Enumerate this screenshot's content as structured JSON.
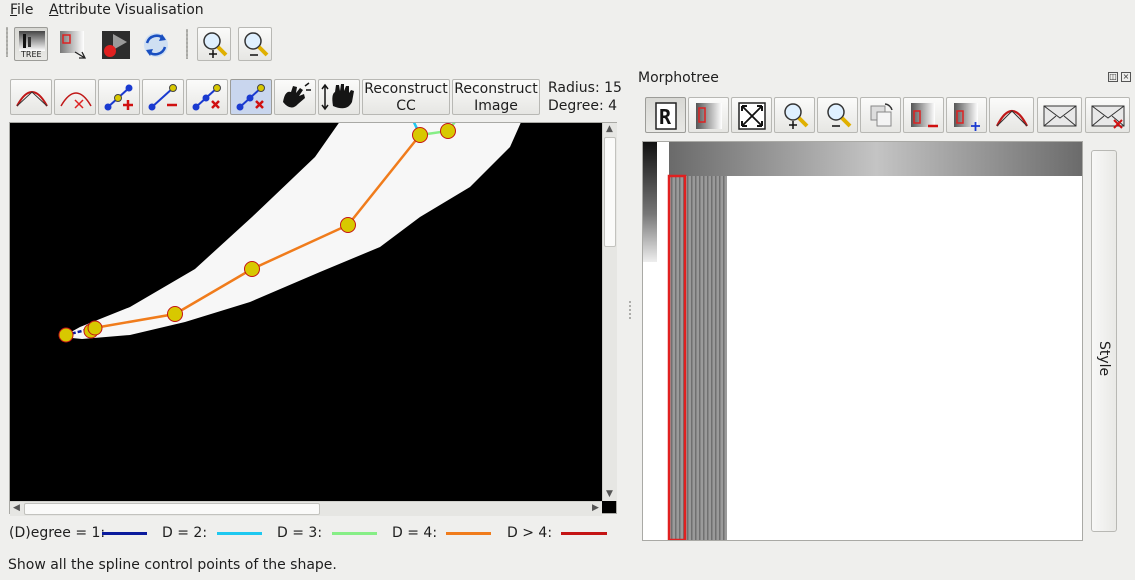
{
  "menu": [
    {
      "label": "File"
    },
    {
      "label": "Attribute Visualisation"
    }
  ],
  "main_toolbar": {
    "tree_icon_label": "TREE"
  },
  "spline_toolbar": {
    "reconstruct_cc": [
      "Reconstruct",
      "CC"
    ],
    "reconstruct_image": [
      "Reconstruct",
      "Image"
    ],
    "radius": "Radius: 15",
    "degree": "Degree: 4"
  },
  "legend": {
    "items": [
      {
        "label": "(D)egree = 1:",
        "color": "#0a1a9c"
      },
      {
        "label": "D = 2:",
        "color": "#1ec8f0"
      },
      {
        "label": "D = 3:",
        "color": "#86ee86"
      },
      {
        "label": "D = 4:",
        "color": "#f07c1c"
      },
      {
        "label": "D > 4:",
        "color": "#c41414"
      }
    ]
  },
  "status_text": "Show all the spline control points of the shape.",
  "panel": {
    "title": "Morphotree",
    "style_tab": "Style"
  },
  "colors": {
    "shape_fill": "#f7f7f7",
    "control_point_fill": "#d8c800",
    "control_point_stroke": "#c41414",
    "selection_rect": "#e02020"
  }
}
